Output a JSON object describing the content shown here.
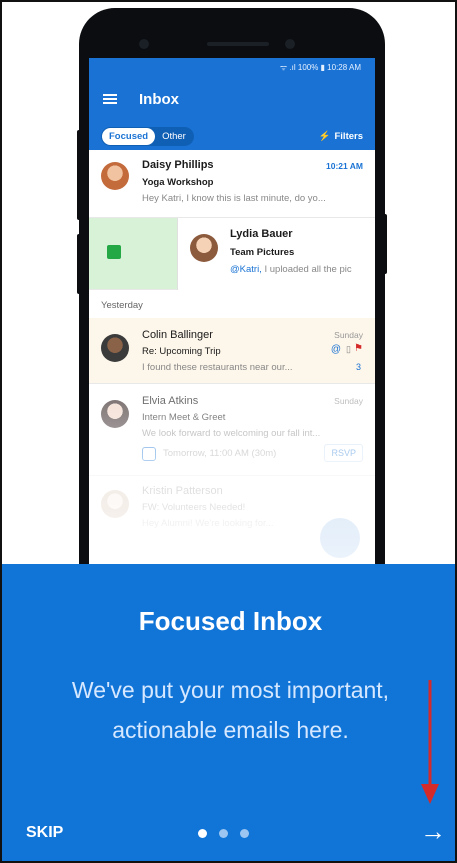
{
  "status_bar": {
    "text": "ᯤ .ıl 100% ▮ 10:28 AM"
  },
  "app_bar": {
    "title": "Inbox"
  },
  "filter_bar": {
    "tabs": [
      {
        "label": "Focused"
      },
      {
        "label": "Other"
      }
    ],
    "filters_label": "Filters"
  },
  "messages": [
    {
      "sender": "Daisy Phillips",
      "subject": "Yoga Workshop",
      "preview": "Hey Katri, I know this is last minute, do yo...",
      "time": "10:21 AM"
    },
    {
      "sender": "Lydia Bauer",
      "subject": "Team Pictures",
      "preview_mention": "@Katri,",
      "preview": " I uploaded all the pic"
    },
    {
      "sender": "Colin Ballinger",
      "subject": "Re: Upcoming Trip",
      "preview": "I found these restaurants near our...",
      "time": "Sunday",
      "count": "3"
    },
    {
      "sender": "Elvia Atkins",
      "subject": "Intern Meet & Greet",
      "preview": "We look forward to welcoming our fall int...",
      "time": "Sunday",
      "event": "Tomorrow, 11:00 AM (30m)",
      "rsvp": "RSVP"
    },
    {
      "sender": "Kristin Patterson",
      "subject": "FW: Volunteers Needed!",
      "preview": "Hey Alumni! We're looking for..."
    }
  ],
  "section": {
    "yesterday": "Yesterday"
  },
  "onboarding": {
    "title": "Focused Inbox",
    "body_line1": "We've put your most important,",
    "body_line2": "actionable emails here.",
    "skip": "SKIP",
    "next": "→",
    "page_count": 3,
    "current_page": 1
  },
  "colors": {
    "accent": "#1a73d4",
    "panel": "#1175d8",
    "annotation_arrow": "#d42a2a"
  }
}
